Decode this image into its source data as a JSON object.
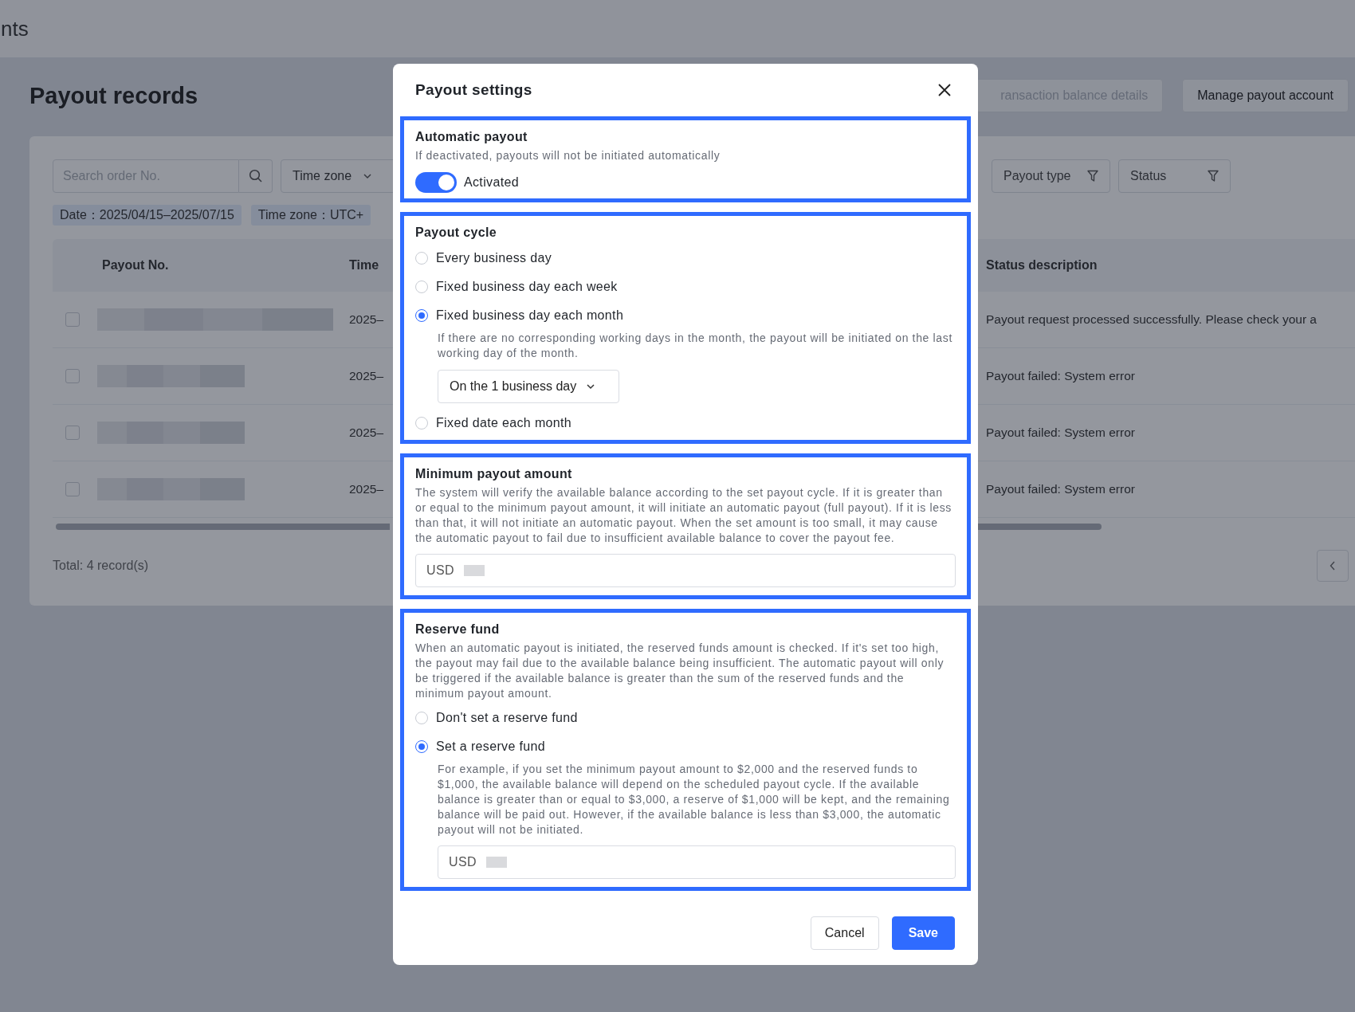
{
  "header": {
    "title": "nts"
  },
  "page": {
    "title": "Payout records",
    "actions": [
      {
        "label": "ransaction balance details",
        "disabled": true
      },
      {
        "label": "Manage payout account",
        "disabled": false
      }
    ],
    "search": {
      "placeholder": "Search order No."
    },
    "time_zone_select": {
      "value": "Time zone"
    },
    "filters": [
      {
        "label": "Payout type"
      },
      {
        "label": "Status"
      }
    ],
    "tags": [
      "Date：2025/04/15–2025/07/15",
      "Time zone：UTC+"
    ],
    "table": {
      "columns": [
        "Payout No.",
        "Time",
        "Status description"
      ],
      "rows": [
        {
          "checked": false,
          "time": "2025–",
          "status": "Payout request processed successfully. Please check your a"
        },
        {
          "checked": false,
          "time": "2025–",
          "status": "Payout failed: System error"
        },
        {
          "checked": false,
          "time": "2025–",
          "status": "Payout failed: System error"
        },
        {
          "checked": false,
          "time": "2025–",
          "status": "Payout failed: System error"
        }
      ]
    },
    "total": "Total: 4 record(s)"
  },
  "modal": {
    "title": "Payout settings",
    "sections": [
      {
        "kind": "toggle",
        "highlighted": true,
        "title": "Automatic payout",
        "description": "If deactivated, payouts will not be initiated automatically",
        "toggle": {
          "on": true,
          "label": "Activated"
        }
      },
      {
        "kind": "radio",
        "highlighted": true,
        "title": "Payout cycle",
        "options": [
          {
            "label": "Every business day",
            "selected": false
          },
          {
            "label": "Fixed business day each week",
            "selected": false
          },
          {
            "label": "Fixed business day each month",
            "selected": true,
            "note": "If there are no corresponding working days in the month, the payout will be initiated on the last working day of the month.",
            "select": {
              "value": "On the 1 business day"
            }
          },
          {
            "label": "Fixed date each month",
            "selected": false
          }
        ]
      },
      {
        "kind": "amount",
        "highlighted": true,
        "title": "Minimum payout amount",
        "description": "The system will verify the available balance according to the set payout cycle. If it is greater than or equal to the minimum payout amount, it will initiate an automatic payout (full payout). If it is less than that, it will not initiate an automatic payout. When the set amount is too small, it may cause the automatic payout to fail due to insufficient available balance to cover the payout fee.",
        "field": {
          "prefix": "USD"
        }
      },
      {
        "kind": "radio",
        "highlighted": true,
        "title": "Reserve fund",
        "description": "When an automatic payout is initiated, the reserved funds amount is checked. If it's set too high, the payout may fail due to the available balance being insufficient. The automatic payout will only be triggered if the available balance is greater than the sum of the reserved funds and the minimum payout amount.",
        "options": [
          {
            "label": "Don't set a reserve fund",
            "selected": false
          },
          {
            "label": "Set a reserve fund",
            "selected": true,
            "note": "For example, if you set the minimum payout amount to $2,000 and the reserved funds to $1,000, the available balance will depend on the scheduled payout cycle. If the available balance is greater than or equal to $3,000, a reserve of $1,000 will be kept, and the remaining balance will be paid out. However, if the available balance is less than $3,000, the automatic payout will not be initiated.",
            "field": {
              "prefix": "USD"
            }
          }
        ]
      }
    ],
    "buttons": [
      {
        "label": "Cancel",
        "kind": "secondary"
      },
      {
        "label": "Save",
        "kind": "primary"
      }
    ]
  }
}
